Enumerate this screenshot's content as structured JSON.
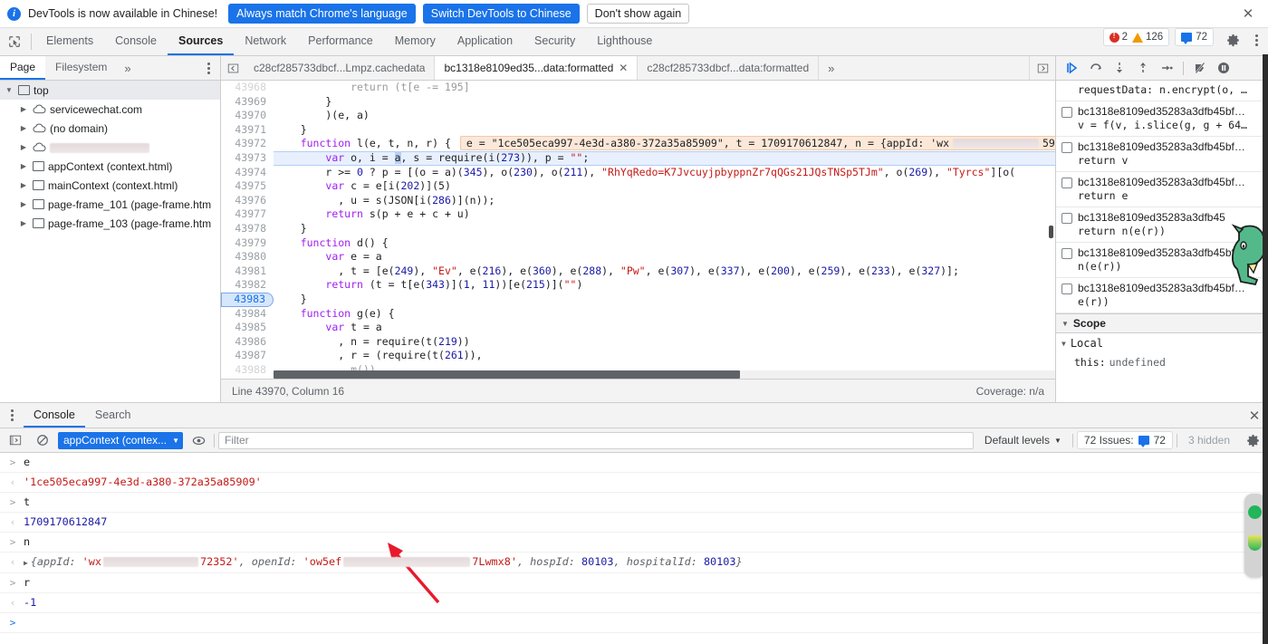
{
  "infobar": {
    "message": "DevTools is now available in Chinese!",
    "btn_always": "Always match Chrome's language",
    "btn_switch": "Switch DevTools to Chinese",
    "btn_dismiss": "Don't show again",
    "close": "✕"
  },
  "main_tabs": [
    {
      "label": "Elements",
      "active": false
    },
    {
      "label": "Console",
      "active": false
    },
    {
      "label": "Sources",
      "active": true
    },
    {
      "label": "Network",
      "active": false
    },
    {
      "label": "Performance",
      "active": false
    },
    {
      "label": "Memory",
      "active": false
    },
    {
      "label": "Application",
      "active": false
    },
    {
      "label": "Security",
      "active": false
    },
    {
      "label": "Lighthouse",
      "active": false
    }
  ],
  "counters": {
    "errors": "2",
    "warnings": "126",
    "messages": "72"
  },
  "navigator": {
    "tabs": [
      {
        "label": "Page",
        "active": true
      },
      {
        "label": "Filesystem",
        "active": false
      }
    ],
    "more": "»",
    "tree": [
      {
        "label": "top",
        "type": "frame",
        "depth": 0,
        "selected": true,
        "expanded": true
      },
      {
        "label": "servicewechat.com",
        "type": "cloud",
        "depth": 1,
        "expanded": false
      },
      {
        "label": "(no domain)",
        "type": "cloud",
        "depth": 1,
        "expanded": false
      },
      {
        "label": "",
        "type": "cloud",
        "depth": 1,
        "expanded": false,
        "redacted": true
      },
      {
        "label": "appContext (context.html)",
        "type": "frame",
        "depth": 1,
        "expanded": false
      },
      {
        "label": "mainContext (context.html)",
        "type": "frame",
        "depth": 1,
        "expanded": false
      },
      {
        "label": "page-frame_101 (page-frame.htm",
        "type": "frame",
        "depth": 1,
        "expanded": false
      },
      {
        "label": "page-frame_103 (page-frame.htm",
        "type": "frame",
        "depth": 1,
        "expanded": false
      }
    ]
  },
  "source_tabs": [
    {
      "label": "c28cf285733dbcf...Lmpz.cachedata",
      "active": false,
      "closable": false
    },
    {
      "label": "bc1318e8109ed35...data:formatted",
      "active": true,
      "closable": true
    },
    {
      "label": "c28cf285733dbcf...data:formatted",
      "active": false,
      "closable": false
    }
  ],
  "editor": {
    "lines": [
      {
        "n": "43968",
        "segments": [
          {
            "t": "            return (t[e -= 195]",
            "c": "plain"
          }
        ],
        "clipped": true
      },
      {
        "n": "43969",
        "segments": [
          {
            "t": "        }",
            "c": "plain"
          }
        ]
      },
      {
        "n": "43970",
        "segments": [
          {
            "t": "        )(e, a)",
            "c": "plain"
          }
        ]
      },
      {
        "n": "43971",
        "segments": [
          {
            "t": "    }",
            "c": "plain"
          }
        ]
      },
      {
        "n": "43972",
        "segments": [
          {
            "t": "    ",
            "c": "plain"
          },
          {
            "t": "function",
            "c": "kw"
          },
          {
            "t": " l(e, t, n, r) {",
            "c": "plain"
          }
        ],
        "popup": "e = \"1ce505eca997-4e3d-a380-372a35a85909\", t = 1709170612847, n = {appId: 'wx",
        "popup_redacted": true,
        "popup_tail": "59"
      },
      {
        "n": "43973",
        "highlight": true,
        "segments": [
          {
            "t": "        ",
            "c": "plain"
          },
          {
            "t": "var",
            "c": "kw"
          },
          {
            "t": " o, i = ",
            "c": "plain"
          },
          {
            "t": "a",
            "c": "sel"
          },
          {
            "t": ", s = require(i(",
            "c": "plain"
          },
          {
            "t": "273",
            "c": "num"
          },
          {
            "t": ")), p = ",
            "c": "plain"
          },
          {
            "t": "\"\"",
            "c": "str"
          },
          {
            "t": ";",
            "c": "plain"
          }
        ]
      },
      {
        "n": "43974",
        "segments": [
          {
            "t": "        r >= ",
            "c": "plain"
          },
          {
            "t": "0",
            "c": "num"
          },
          {
            "t": " ? p = [(o = a)(",
            "c": "plain"
          },
          {
            "t": "345",
            "c": "num"
          },
          {
            "t": "), o(",
            "c": "plain"
          },
          {
            "t": "230",
            "c": "num"
          },
          {
            "t": "), o(",
            "c": "plain"
          },
          {
            "t": "211",
            "c": "num"
          },
          {
            "t": "), ",
            "c": "plain"
          },
          {
            "t": "\"RhYqRedo=K7JvcuyjpbyppnZr7qQGs21JQsTNSp5TJm\"",
            "c": "str"
          },
          {
            "t": ", o(",
            "c": "plain"
          },
          {
            "t": "269",
            "c": "num"
          },
          {
            "t": "), ",
            "c": "plain"
          },
          {
            "t": "\"Tyrcs\"",
            "c": "str"
          },
          {
            "t": "][o(",
            "c": "plain"
          }
        ]
      },
      {
        "n": "43975",
        "segments": [
          {
            "t": "        ",
            "c": "plain"
          },
          {
            "t": "var",
            "c": "kw"
          },
          {
            "t": " c = e[i(",
            "c": "plain"
          },
          {
            "t": "202",
            "c": "num"
          },
          {
            "t": ")](5)",
            "c": "plain"
          }
        ]
      },
      {
        "n": "43976",
        "segments": [
          {
            "t": "          , u = s(JSON[i(",
            "c": "plain"
          },
          {
            "t": "286",
            "c": "num"
          },
          {
            "t": ")](n));",
            "c": "plain"
          }
        ]
      },
      {
        "n": "43977",
        "segments": [
          {
            "t": "        ",
            "c": "plain"
          },
          {
            "t": "return",
            "c": "kw"
          },
          {
            "t": " s(p + e + c + u)",
            "c": "plain"
          }
        ]
      },
      {
        "n": "43978",
        "segments": [
          {
            "t": "    }",
            "c": "plain"
          }
        ]
      },
      {
        "n": "43979",
        "segments": [
          {
            "t": "    ",
            "c": "plain"
          },
          {
            "t": "function",
            "c": "kw"
          },
          {
            "t": " d() {",
            "c": "plain"
          }
        ]
      },
      {
        "n": "43980",
        "segments": [
          {
            "t": "        ",
            "c": "plain"
          },
          {
            "t": "var",
            "c": "kw"
          },
          {
            "t": " e = a",
            "c": "plain"
          }
        ]
      },
      {
        "n": "43981",
        "segments": [
          {
            "t": "          , t = [e(",
            "c": "plain"
          },
          {
            "t": "249",
            "c": "num"
          },
          {
            "t": "), ",
            "c": "plain"
          },
          {
            "t": "\"Ev\"",
            "c": "str"
          },
          {
            "t": ", e(",
            "c": "plain"
          },
          {
            "t": "216",
            "c": "num"
          },
          {
            "t": "), e(",
            "c": "plain"
          },
          {
            "t": "360",
            "c": "num"
          },
          {
            "t": "), e(",
            "c": "plain"
          },
          {
            "t": "288",
            "c": "num"
          },
          {
            "t": "), ",
            "c": "plain"
          },
          {
            "t": "\"Pw\"",
            "c": "str"
          },
          {
            "t": ", e(",
            "c": "plain"
          },
          {
            "t": "307",
            "c": "num"
          },
          {
            "t": "), e(",
            "c": "plain"
          },
          {
            "t": "337",
            "c": "num"
          },
          {
            "t": "), e(",
            "c": "plain"
          },
          {
            "t": "200",
            "c": "num"
          },
          {
            "t": "), e(",
            "c": "plain"
          },
          {
            "t": "259",
            "c": "num"
          },
          {
            "t": "), e(",
            "c": "plain"
          },
          {
            "t": "233",
            "c": "num"
          },
          {
            "t": "), e(",
            "c": "plain"
          },
          {
            "t": "327",
            "c": "num"
          },
          {
            "t": ")];",
            "c": "plain"
          }
        ]
      },
      {
        "n": "43982",
        "segments": [
          {
            "t": "        ",
            "c": "plain"
          },
          {
            "t": "return",
            "c": "kw"
          },
          {
            "t": " (t = t[e(",
            "c": "plain"
          },
          {
            "t": "343",
            "c": "num"
          },
          {
            "t": ")](",
            "c": "plain"
          },
          {
            "t": "1",
            "c": "num"
          },
          {
            "t": ", ",
            "c": "plain"
          },
          {
            "t": "11",
            "c": "num"
          },
          {
            "t": "))[e(",
            "c": "plain"
          },
          {
            "t": "215",
            "c": "num"
          },
          {
            "t": ")](",
            "c": "plain"
          },
          {
            "t": "\"\"",
            "c": "str"
          },
          {
            "t": ")",
            "c": "plain"
          }
        ]
      },
      {
        "n": "43983",
        "breakpoint": true,
        "segments": [
          {
            "t": "    }",
            "c": "plain"
          }
        ]
      },
      {
        "n": "43984",
        "segments": [
          {
            "t": "    ",
            "c": "plain"
          },
          {
            "t": "function",
            "c": "kw"
          },
          {
            "t": " g(e) {",
            "c": "plain"
          }
        ]
      },
      {
        "n": "43985",
        "segments": [
          {
            "t": "        ",
            "c": "plain"
          },
          {
            "t": "var",
            "c": "kw"
          },
          {
            "t": " t = a",
            "c": "plain"
          }
        ]
      },
      {
        "n": "43986",
        "segments": [
          {
            "t": "          , n = require(t(",
            "c": "plain"
          },
          {
            "t": "219",
            "c": "num"
          },
          {
            "t": "))",
            "c": "plain"
          }
        ]
      },
      {
        "n": "43987",
        "segments": [
          {
            "t": "          , r = (require(t(",
            "c": "plain"
          },
          {
            "t": "261",
            "c": "num"
          },
          {
            "t": ")),",
            "c": "plain"
          }
        ]
      },
      {
        "n": "43988",
        "segments": [
          {
            "t": "            m())",
            "c": "plain"
          }
        ],
        "clipped": true
      }
    ],
    "status_left": "Line 43970, Column 16",
    "status_right": "Coverage: n/a"
  },
  "debugger": {
    "toolbar_icons": [
      "resume-script",
      "step-over",
      "step-into",
      "step-out",
      "step",
      "deactivate-breakpoints",
      "pause-on-exceptions"
    ],
    "breakpoints_partial_top": "requestData: n.encrypt(o, …",
    "breakpoints": [
      {
        "file": "bc1318e8109ed35283a3dfb45bf…",
        "code": "v = f(v, i.slice(g, g + 64…"
      },
      {
        "file": "bc1318e8109ed35283a3dfb45bf…",
        "code": "return v"
      },
      {
        "file": "bc1318e8109ed35283a3dfb45bf…",
        "code": "return e"
      },
      {
        "file": "bc1318e8109ed35283a3dfb45",
        "code": "return n(e(r))"
      },
      {
        "file": "bc1318e8109ed35283a3dfb45bf.",
        "code": "n(e(r))"
      },
      {
        "file": "bc1318e8109ed35283a3dfb45bf…",
        "code": "e(r))"
      }
    ],
    "scope_label": "Scope",
    "local_label": "Local",
    "local_rows": [
      {
        "name": "this:",
        "value": "undefined"
      }
    ]
  },
  "drawer": {
    "tabs": [
      {
        "label": "Console",
        "active": true
      },
      {
        "label": "Search",
        "active": false
      }
    ],
    "close": "✕",
    "context": "appContext (contex...",
    "filter_placeholder": "Filter",
    "levels": "Default levels",
    "issues": "72 Issues:",
    "issues_count": "72",
    "hidden": "3 hidden"
  },
  "console_log": [
    {
      "kind": "input",
      "text": "e"
    },
    {
      "kind": "output",
      "type": "string",
      "text": "'1ce505eca997-4e3d-a380-372a35a85909'"
    },
    {
      "kind": "input",
      "text": "t"
    },
    {
      "kind": "output",
      "type": "number",
      "text": "1709170612847"
    },
    {
      "kind": "input",
      "text": "n"
    },
    {
      "kind": "output",
      "type": "object",
      "prefix": "{appId: ",
      "app_id_head": "'wx",
      "app_id_tail": "72352'",
      "mid": ", openId: ",
      "open_id_head": "'ow5ef",
      "open_id_tail": "7Lwmx8'",
      "suffix": ", hospId: ",
      "hosp_id": "80103",
      "suffix2": ", hospitalId: ",
      "hospital_id": "80103",
      "end": "}"
    },
    {
      "kind": "input",
      "text": "r"
    },
    {
      "kind": "output",
      "type": "number",
      "text": "-1"
    },
    {
      "kind": "prompt",
      "text": ""
    }
  ]
}
